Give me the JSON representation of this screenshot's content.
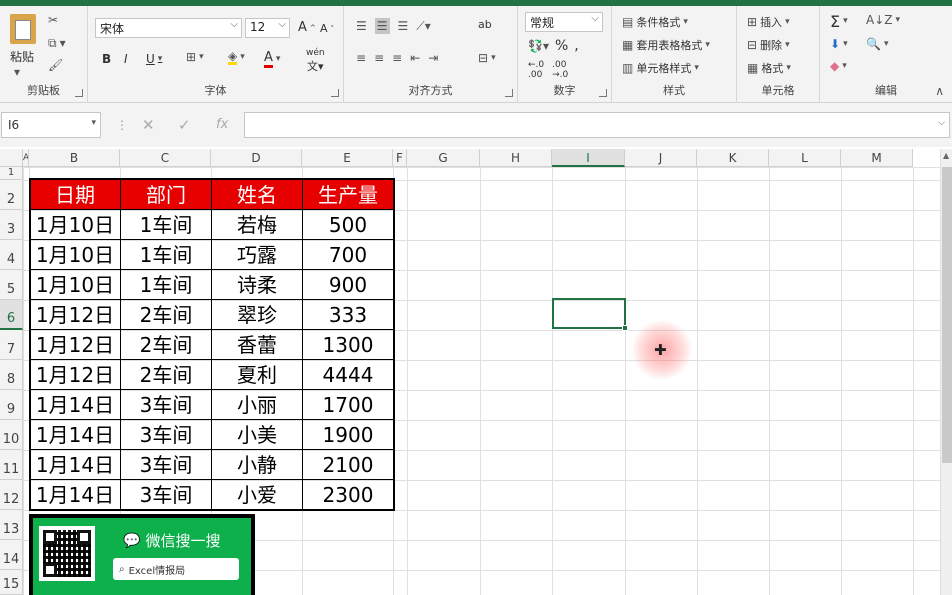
{
  "ribbon": {
    "clipboard": {
      "paste": "粘贴",
      "label": "剪贴板"
    },
    "font": {
      "name": "宋体",
      "size": "12",
      "label": "字体",
      "grow": "A",
      "shrink": "A",
      "bold": "B",
      "italic": "I",
      "underline": "U",
      "wen": "wén",
      "fontcolor": "A"
    },
    "alignment": {
      "label": "对齐方式",
      "wrap": "ab"
    },
    "number": {
      "format": "常规",
      "label": "数字",
      "percent": "%",
      "comma": ","
    },
    "styles": {
      "cond": "条件格式",
      "table": "套用表格格式",
      "cell": "单元格样式",
      "label": "样式"
    },
    "cells": {
      "insert": "插入",
      "delete": "删除",
      "format": "格式",
      "label": "单元格"
    },
    "editing": {
      "label": "编辑",
      "sum": "Σ"
    }
  },
  "formula": {
    "namebox": "I6",
    "fx": "fx",
    "value": ""
  },
  "columns": [
    "A",
    "B",
    "C",
    "D",
    "E",
    "F",
    "G",
    "H",
    "I",
    "J",
    "K",
    "L",
    "M"
  ],
  "rows": [
    "1",
    "2",
    "3",
    "4",
    "5",
    "6",
    "7",
    "8",
    "9",
    "10",
    "11",
    "12",
    "13",
    "14",
    "15"
  ],
  "table": {
    "headers": [
      "日期",
      "部门",
      "姓名",
      "生产量"
    ],
    "rows": [
      [
        "1月10日",
        "1车间",
        "若梅",
        "500"
      ],
      [
        "1月10日",
        "1车间",
        "巧露",
        "700"
      ],
      [
        "1月10日",
        "1车间",
        "诗柔",
        "900"
      ],
      [
        "1月12日",
        "2车间",
        "翠珍",
        "333"
      ],
      [
        "1月12日",
        "2车间",
        "香蕾",
        "1300"
      ],
      [
        "1月12日",
        "2车间",
        "夏利",
        "4444"
      ],
      [
        "1月14日",
        "3车间",
        "小丽",
        "1700"
      ],
      [
        "1月14日",
        "3车间",
        "小美",
        "1900"
      ],
      [
        "1月14日",
        "3车间",
        "小静",
        "2100"
      ],
      [
        "1月14日",
        "3车间",
        "小爱",
        "2300"
      ]
    ]
  },
  "banner": {
    "title": "微信搜一搜",
    "search": "Excel情报局"
  },
  "colors": {
    "header_red": "#e60000",
    "accent_green": "#217346",
    "banner_green": "#0db04b"
  }
}
